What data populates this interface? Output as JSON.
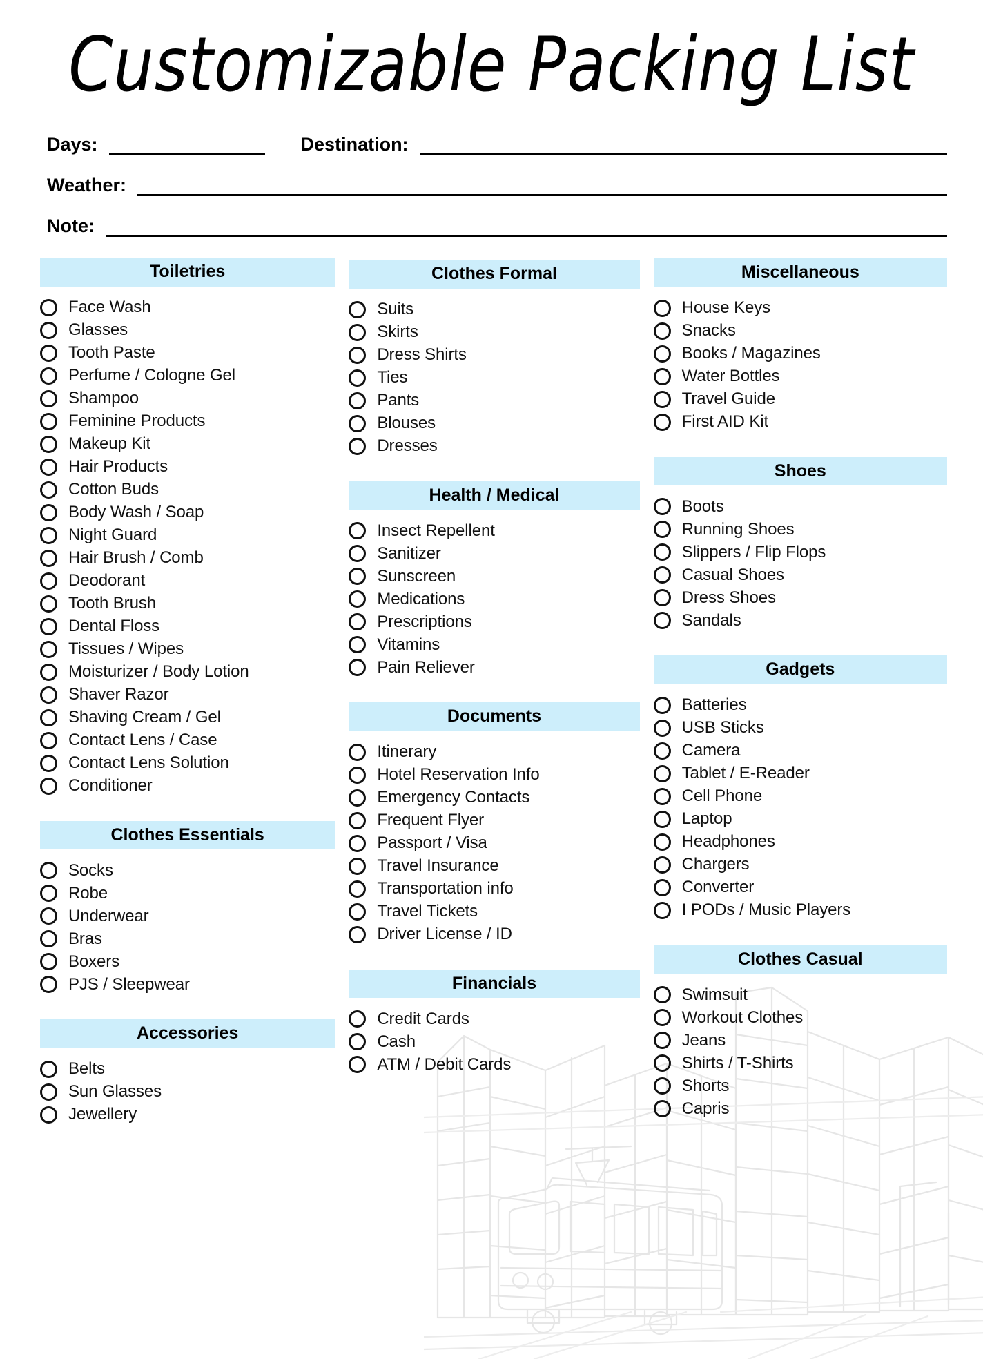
{
  "document": {
    "title": "Customizable Packing List",
    "accent_color": "#cdeefb",
    "text_color": "#111111"
  },
  "fields": [
    {
      "label": "Days:",
      "value": ""
    },
    {
      "label": "Destination:",
      "value": ""
    },
    {
      "label": "Weather:",
      "value": ""
    },
    {
      "label": "Note:",
      "value": ""
    }
  ],
  "columns": [
    {
      "sections": [
        {
          "title": "Toiletries",
          "items": [
            "Face Wash",
            "Glasses",
            "Tooth Paste",
            "Perfume / Cologne Gel",
            "Shampoo",
            "Feminine Products",
            "Makeup Kit",
            "Hair Products",
            "Cotton Buds",
            "Body Wash / Soap",
            "Night Guard",
            "Hair Brush / Comb",
            "Deodorant",
            "Tooth Brush",
            "Dental Floss",
            "Tissues / Wipes",
            "Moisturizer / Body Lotion",
            "Shaver Razor",
            "Shaving Cream / Gel",
            "Contact Lens / Case",
            "Contact Lens Solution",
            "Conditioner"
          ]
        },
        {
          "title": "Clothes Essentials",
          "items": [
            "Socks",
            "Robe",
            "Underwear",
            "Bras",
            "Boxers",
            "PJS / Sleepwear"
          ]
        },
        {
          "title": "Accessories",
          "items": [
            "Belts",
            "Sun Glasses",
            "Jewellery"
          ]
        }
      ]
    },
    {
      "sections": [
        {
          "title": "Clothes Formal",
          "items": [
            "Suits",
            "Skirts",
            "Dress Shirts",
            "Ties",
            "Pants",
            "Blouses",
            "Dresses"
          ]
        },
        {
          "title": "Health / Medical",
          "items": [
            "Insect Repellent",
            "Sanitizer",
            "Sunscreen",
            "Medications",
            "Prescriptions",
            "Vitamins",
            "Pain Reliever"
          ]
        },
        {
          "title": "Documents",
          "items": [
            "Itinerary",
            "Hotel Reservation Info",
            "Emergency Contacts",
            "Frequent Flyer",
            "Passport / Visa",
            "Travel Insurance",
            "Transportation info",
            "Travel Tickets",
            "Driver License / ID"
          ]
        },
        {
          "title": "Financials",
          "items": [
            "Credit Cards",
            "Cash",
            "ATM / Debit Cards"
          ]
        }
      ]
    },
    {
      "sections": [
        {
          "title": "Miscellaneous",
          "items": [
            "House Keys",
            "Snacks",
            "Books / Magazines",
            "Water Bottles",
            "Travel Guide",
            "First AID Kit"
          ]
        },
        {
          "title": "Shoes",
          "items": [
            "Boots",
            "Running Shoes",
            "Slippers / Flip Flops",
            "Casual Shoes",
            "Dress Shoes",
            "Sandals"
          ]
        },
        {
          "title": "Gadgets",
          "items": [
            "Batteries",
            "USB Sticks",
            "Camera",
            "Tablet / E-Reader",
            "Cell Phone",
            "Laptop",
            "Headphones",
            "Chargers",
            "Converter",
            "I PODs / Music Players"
          ]
        },
        {
          "title": "Clothes Casual",
          "items": [
            "Swimsuit",
            "Workout Clothes",
            "Jeans",
            "Shirts / T-Shirts",
            "Shorts",
            "Capris"
          ]
        }
      ]
    }
  ]
}
